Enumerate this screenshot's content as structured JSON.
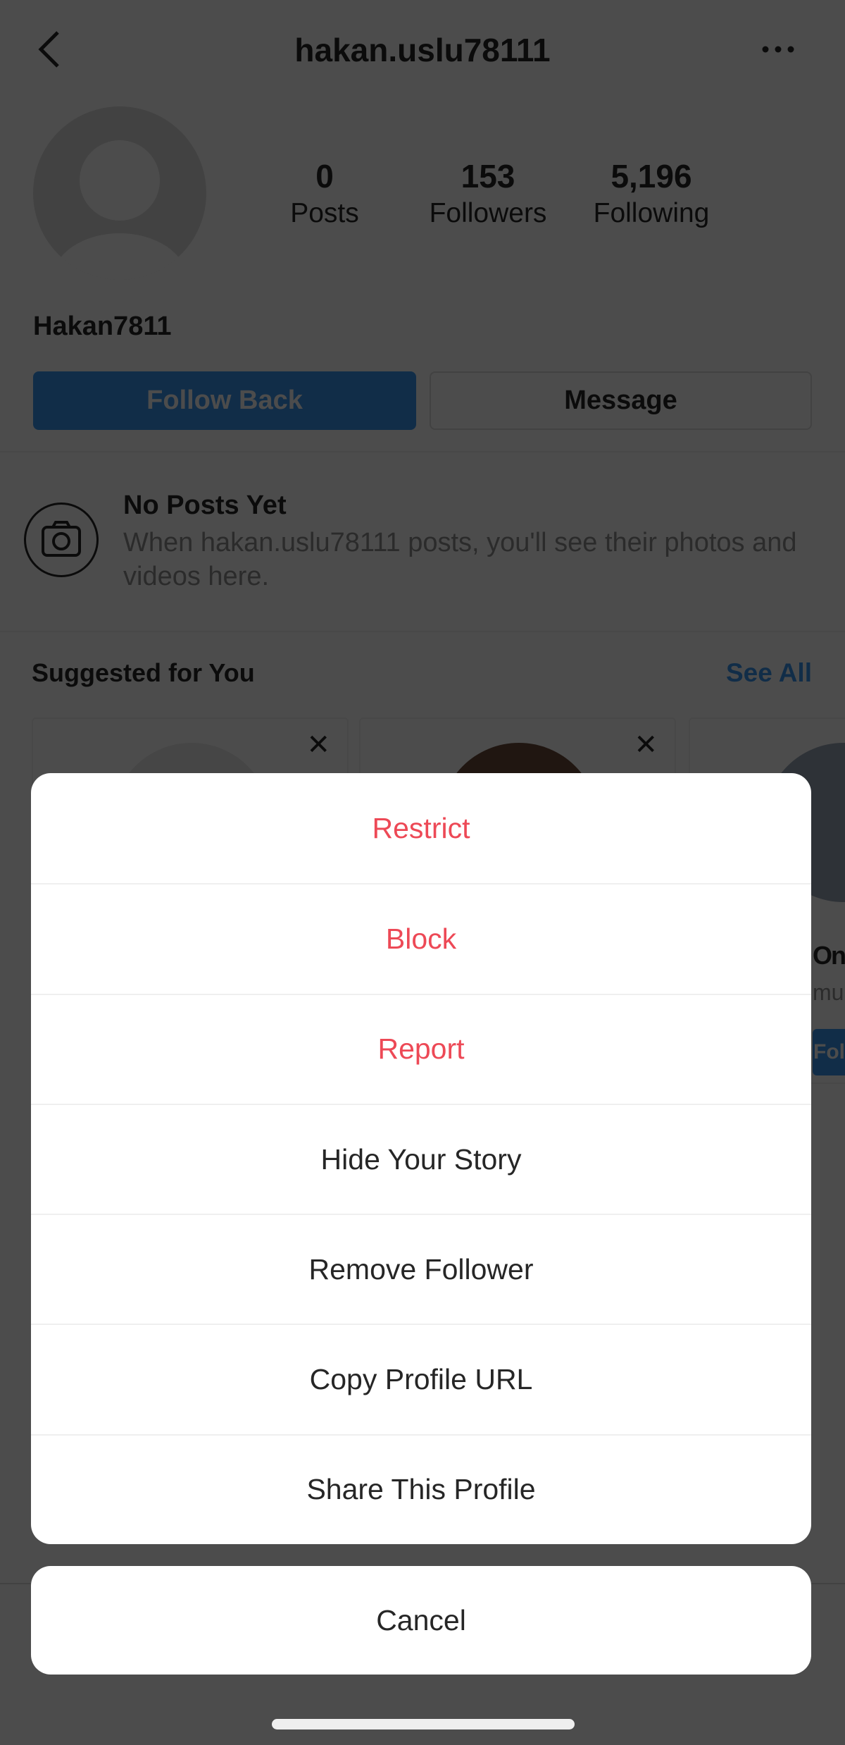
{
  "header": {
    "title": "hakan.uslu78111",
    "back_icon": "chevron-left-icon",
    "more_icon": "ellipsis-icon"
  },
  "profile": {
    "stats": [
      {
        "value": "0",
        "label": "Posts"
      },
      {
        "value": "153",
        "label": "Followers"
      },
      {
        "value": "5,196",
        "label": "Following"
      }
    ],
    "display_name": "Hakan7811",
    "follow_back_label": "Follow Back",
    "message_label": "Message"
  },
  "no_posts": {
    "title": "No Posts Yet",
    "text": "When hakan.uslu78111 posts, you'll see their photos and videos here."
  },
  "suggested": {
    "title": "Suggested for You",
    "see_all": "See All",
    "cards": [
      {
        "name": "",
        "sub": "",
        "button": ""
      },
      {
        "name": "",
        "sub": "",
        "button": ""
      },
      {
        "name": "On",
        "sub": "mu",
        "button": "Fol"
      }
    ]
  },
  "sheet": {
    "items": [
      {
        "label": "Restrict",
        "destructive": true
      },
      {
        "label": "Block",
        "destructive": true
      },
      {
        "label": "Report",
        "destructive": true
      },
      {
        "label": "Hide Your Story",
        "destructive": false
      },
      {
        "label": "Remove Follower",
        "destructive": false
      },
      {
        "label": "Copy Profile URL",
        "destructive": false
      },
      {
        "label": "Share This Profile",
        "destructive": false
      }
    ],
    "cancel_label": "Cancel"
  },
  "colors": {
    "accent": "#3897f0",
    "destructive": "#ed4956",
    "dim_overlay": "#4d4d4d"
  }
}
